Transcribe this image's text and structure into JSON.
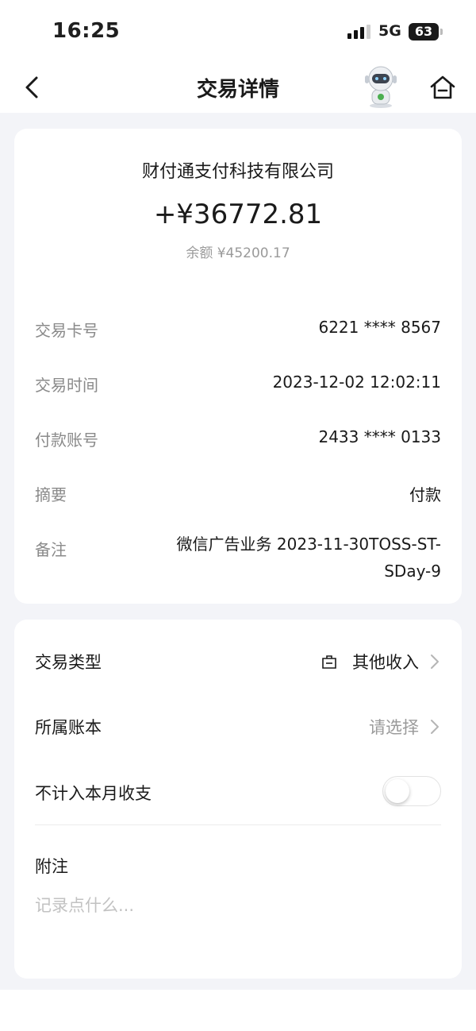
{
  "status_bar": {
    "time": "16:25",
    "network": "5G",
    "battery": "63"
  },
  "nav": {
    "title": "交易详情"
  },
  "summary": {
    "payee": "财付通支付科技有限公司",
    "amount": "+¥36772.81",
    "balance": "余额 ¥45200.17"
  },
  "details": [
    {
      "label": "交易卡号",
      "value": "6221 **** 8567"
    },
    {
      "label": "交易时间",
      "value": "2023-12-02 12:02:11"
    },
    {
      "label": "付款账号",
      "value": "2433 **** 0133"
    },
    {
      "label": "摘要",
      "value": "付款"
    },
    {
      "label": "备注",
      "value": "微信广告业务 2023-11-30TOSS-ST-SDay-9"
    }
  ],
  "settings": {
    "type_label": "交易类型",
    "type_value": "其他收入",
    "book_label": "所属账本",
    "book_value": "请选择",
    "exclude_label": "不计入本月收支",
    "exclude_enabled": false,
    "note_label": "附注",
    "note_placeholder": "记录点什么..."
  },
  "colors": {
    "background": "#f3f4f8",
    "card": "#ffffff",
    "muted_text": "#8a8a8a"
  }
}
